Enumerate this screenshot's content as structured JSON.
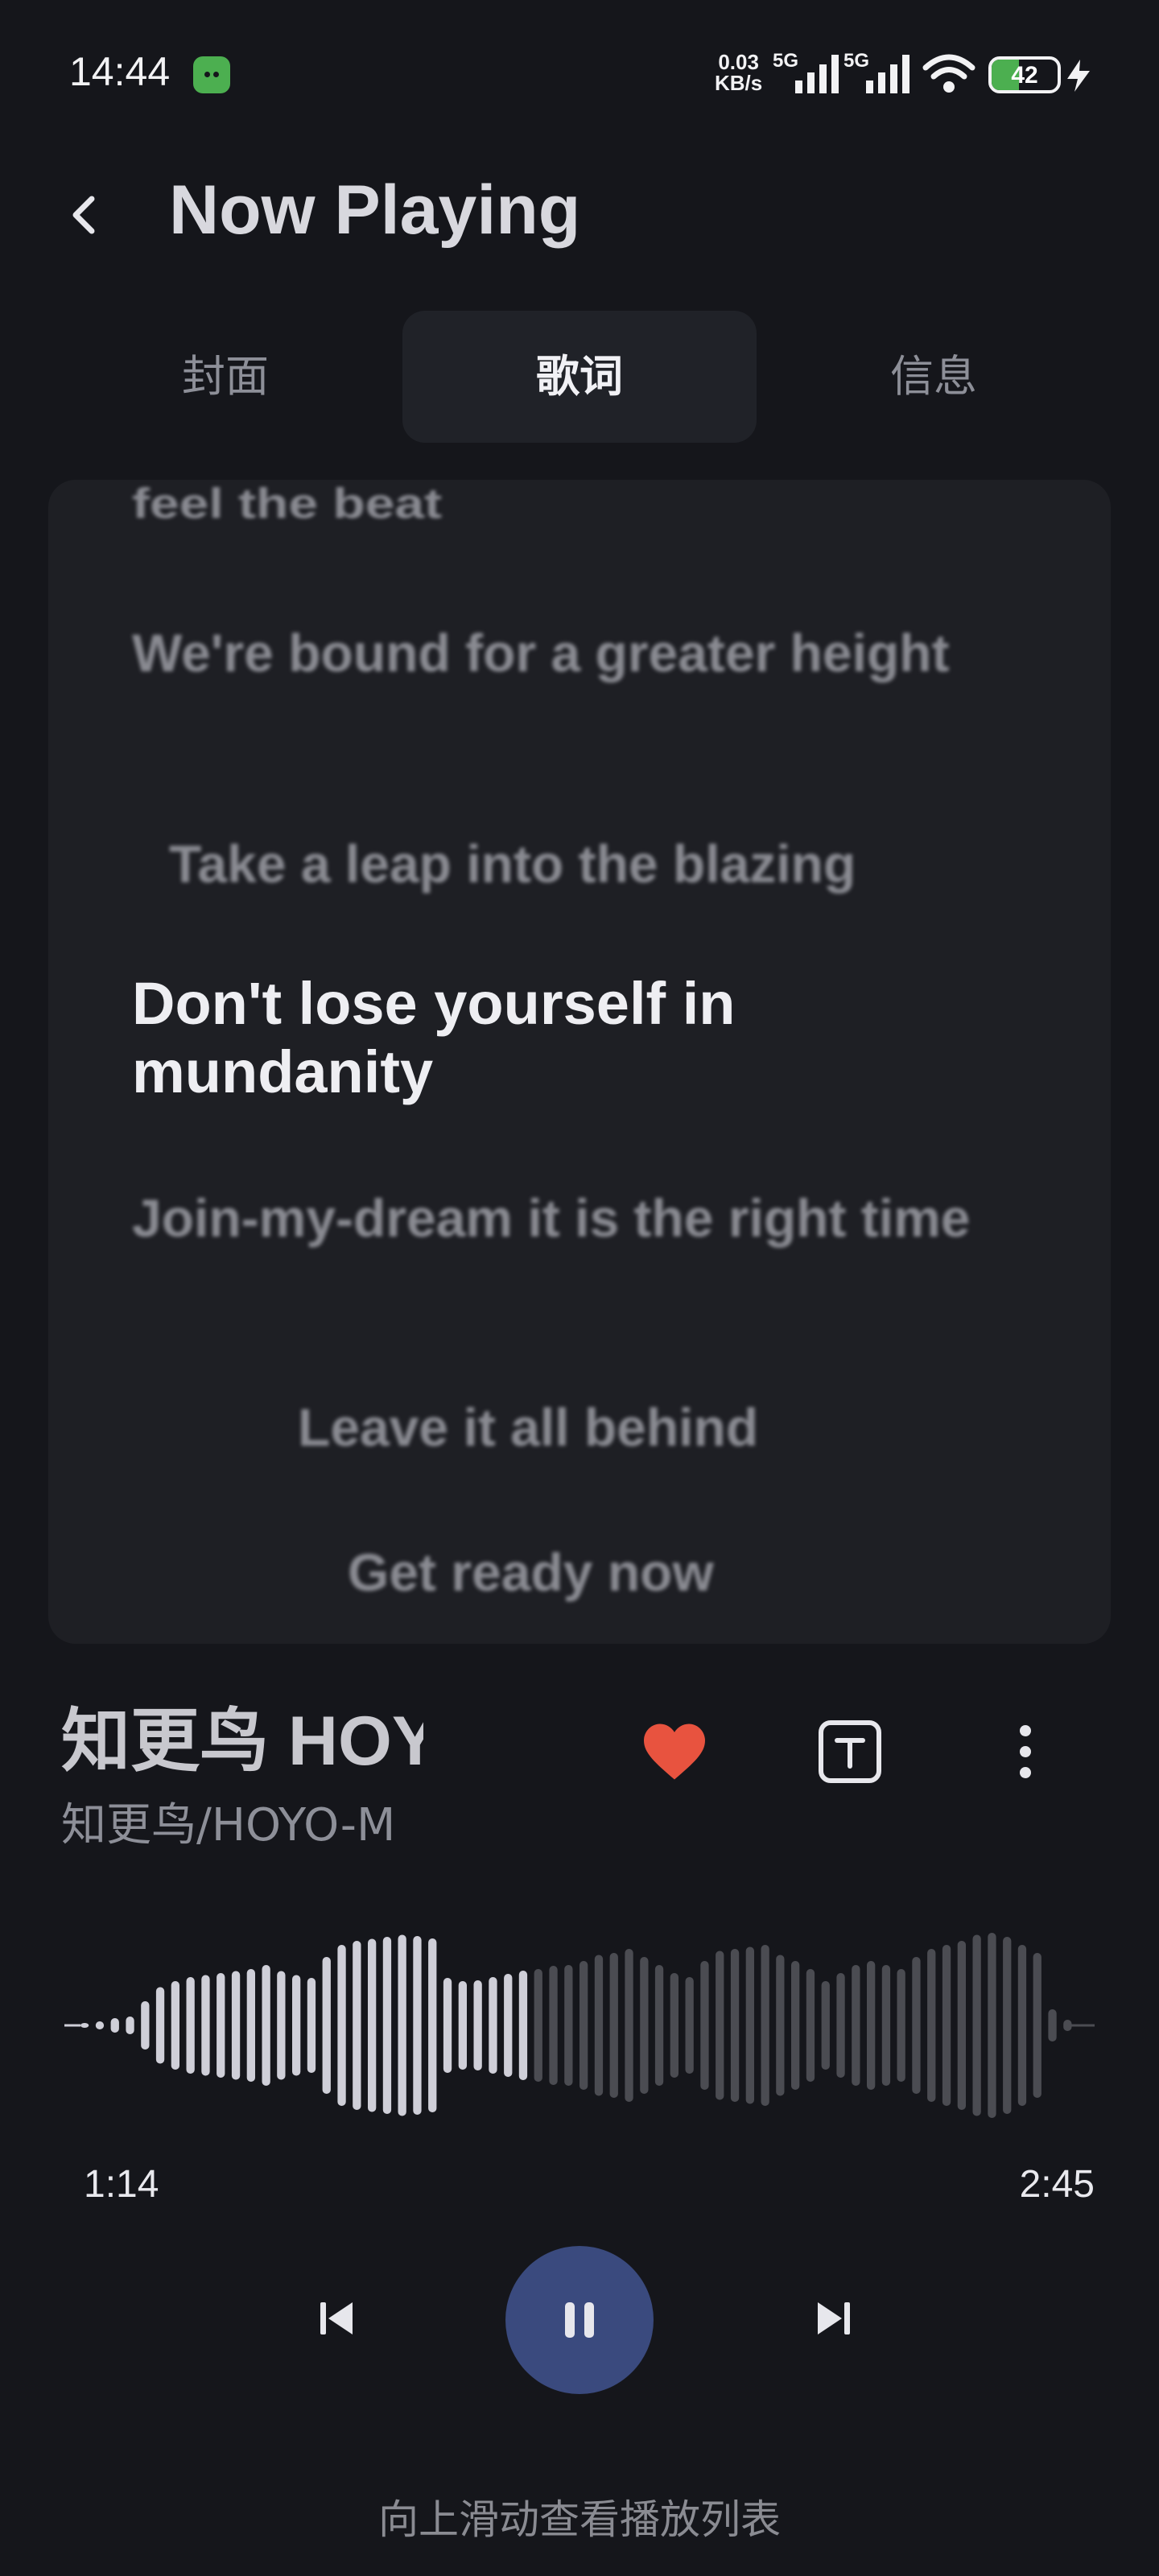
{
  "status_bar": {
    "time": "14:44",
    "net_speed_value": "0.03",
    "net_speed_unit": "KB/s",
    "sim1_label": "5G",
    "sim2_label": "5G",
    "battery": "42"
  },
  "header": {
    "title": "Now Playing"
  },
  "tabs": [
    {
      "label": "封面",
      "active": false
    },
    {
      "label": "歌词",
      "active": true
    },
    {
      "label": "信息",
      "active": false
    }
  ],
  "lyrics": [
    "feel the beat",
    "We're bound for a greater height",
    "Take a leap into the blazing",
    "Don't lose yourself in mundanity",
    "Join-my-dream it is the right time",
    "Leave it all behind",
    "Get ready now"
  ],
  "current_lyric_index": 3,
  "track": {
    "title": "知更鸟 HOY",
    "artist": "知更鸟/HOYO-M",
    "liked": true
  },
  "playback": {
    "current_time": "1:14",
    "total_time": "2:45",
    "progress_fraction": 0.45
  },
  "footer": {
    "hint": "向上滑动查看播放列表"
  },
  "colors": {
    "background": "#15161b",
    "accent_play": "#3a4a7e",
    "heart": "#e8533f",
    "wave_played": "#cfcfd8",
    "wave_unplayed": "#4b4c52"
  }
}
